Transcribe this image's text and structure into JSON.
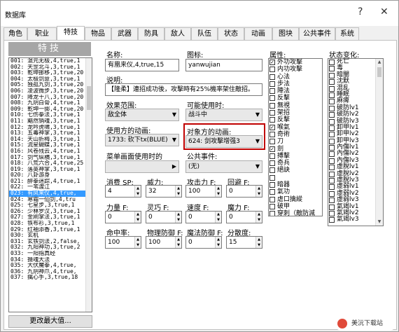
{
  "window": {
    "title": "数据库",
    "help": "?",
    "close": "✕"
  },
  "tabs": [
    "角色",
    "职业",
    "特技",
    "物品",
    "武器",
    "防具",
    "敌人",
    "队伍",
    "状态",
    "动画",
    "图块",
    "公共事件",
    "系统"
  ],
  "active_tab": "特技",
  "list": {
    "header": "特技",
    "items": [
      "001: 混元无极,4,true,1",
      "002: 天罡北斗,3,true,1",
      "003: 乾坤挪移,3,true,20",
      "004: 太极剑意,3,true,1",
      "005: 独孤九剑,3,true,20",
      "006: 凌波微步,3,true,20",
      "007: 降龙十八,3,true,20",
      "008: 九阴白骨,4,true,1",
      "009: 乾坤一掷,4,true,20",
      "010: 七伤拳法,3,true,1",
      "011: 黯然销魂,3,true,1",
      "012: 龙吟虎啸,3,true,1",
      "013: 五毒神掌,3,true,1",
      "014: 天山折梅,3,true,1",
      "015: 流星蝴蝶,3,true,1",
      "016: 风卷残云,4,true,1",
      "017: 剑气纵横,3,true,1",
      "018: 八荒六合,4,true,25",
      "019: 落英神掌,3,true,1",
      "020: 八卦游身",
      "021: 醉拳迷踪,4,true,1",
      "022: 一苇渡江",
      "023: 有凤来仪,4,true,",
      "024: 寒霜一仙剑,4,tru",
      "025: 七星步,3,true,1",
      "026: 少林罗汉,3,true,1",
      "027: 金刚掌法,3,true,1",
      "028: 铁布衫,3,true,1",
      "029: 红袖添香,3,true,1",
      "030: 玄机",
      "031: 玄铁剑法,2,false,",
      "032: 九阳神功,3,true,2",
      "033: 一阳指真经",
      "034: 摄魂大法",
      "035: 大伏魔拳,4,true,",
      "036: 九阴神爪,4,true,",
      "037: 擒心手,3,true,18"
    ],
    "selected_index": 22,
    "max_button": "更改最大值..."
  },
  "form": {
    "name_label": "名称:",
    "name_value": "有凰来仪,4,true,15",
    "icon_label": "图标:",
    "icon_value": "yanwujian",
    "desc_label": "说明:",
    "desc_value": "【隆柔】連招成功後，攻擊時有25%機率架住敵招。",
    "scope_label": "效果范围:",
    "scope_value": "敌全体",
    "occasion_label": "可能使用时:",
    "occasion_value": "战斗中",
    "user_anim_label": "使用方的动画:",
    "user_anim_value": "1733: 砍下tx(BLUE)",
    "target_anim_label": "对象方的动画:",
    "target_anim_value": "624: 剑攻擊增强3",
    "menu_se_label": "菜单画面使用时的",
    "menu_se_value": "",
    "common_event_label": "公共事件:",
    "common_event_value": "(无)",
    "sp_label": "消费 SP:",
    "sp_value": "4",
    "power_label": "威力:",
    "power_value": "32",
    "atk_f_label": "攻击力 F:",
    "atk_f_value": "100",
    "eva_f_label": "回避 F:",
    "eva_f_value": "0",
    "str_f_label": "力量 F:",
    "str_f_value": "0",
    "dex_f_label": "灵巧 F:",
    "dex_f_value": "0",
    "agi_f_label": "速度 F:",
    "agi_f_value": "0",
    "int_f_label": "魔力 F:",
    "int_f_value": "0",
    "hit_label": "命中率:",
    "hit_value": "100",
    "pdef_f_label": "物理防御 F:",
    "pdef_f_value": "100",
    "mdef_f_label": "魔法防御 F:",
    "mdef_f_value": "0",
    "variance_label": "分散度:",
    "variance_value": "15"
  },
  "attributes": {
    "label": "属性:",
    "items": [
      {
        "text": "外功攻擊",
        "checked": true
      },
      {
        "text": "内功攻擊",
        "checked": false
      },
      {
        "text": "心法",
        "checked": false
      },
      {
        "text": "步法",
        "checked": false
      },
      {
        "text": "陣法",
        "checked": false
      },
      {
        "text": "反擊",
        "checked": false
      },
      {
        "text": "無視",
        "checked": false
      },
      {
        "text": "架招",
        "checked": false
      },
      {
        "text": "反擊",
        "checked": false
      },
      {
        "text": "喉氣",
        "checked": true
      },
      {
        "text": "奇術",
        "checked": false
      },
      {
        "text": "刀",
        "checked": false
      },
      {
        "text": "劍",
        "checked": true
      },
      {
        "text": "搏擊",
        "checked": false
      },
      {
        "text": "奇兵",
        "checked": false
      },
      {
        "text": "絕訣",
        "checked": false
      },
      {
        "text": "",
        "checked": false
      },
      {
        "text": "暗器",
        "checked": false
      },
      {
        "text": "氣功",
        "checked": false
      },
      {
        "text": "虐口擒縱",
        "checked": false
      },
      {
        "text": "破甲",
        "checked": false
      },
      {
        "text": "穿刺（敵防減",
        "checked": false
      }
    ]
  },
  "states": {
    "label": "状态变化:",
    "items": [
      "死亡",
      "毒",
      "暗闇",
      "沈默",
      "混乱",
      "睡眠",
      "麻痺",
      "破防lv1",
      "破防lv2",
      "破防lv3",
      "卸甲lv1",
      "卸甲lv2",
      "卸甲lv3",
      "內傷lv1",
      "內傷lv2",
      "內傷lv3",
      "虛脫lv1",
      "虛脫lv2",
      "虛脫lv3",
      "虛弱lv1",
      "虛弱lv2",
      "虛弱lv3",
      "氣竭lv1",
      "氣竭lv2",
      "氣竭lv3"
    ]
  },
  "watermark": "美沅下载站"
}
